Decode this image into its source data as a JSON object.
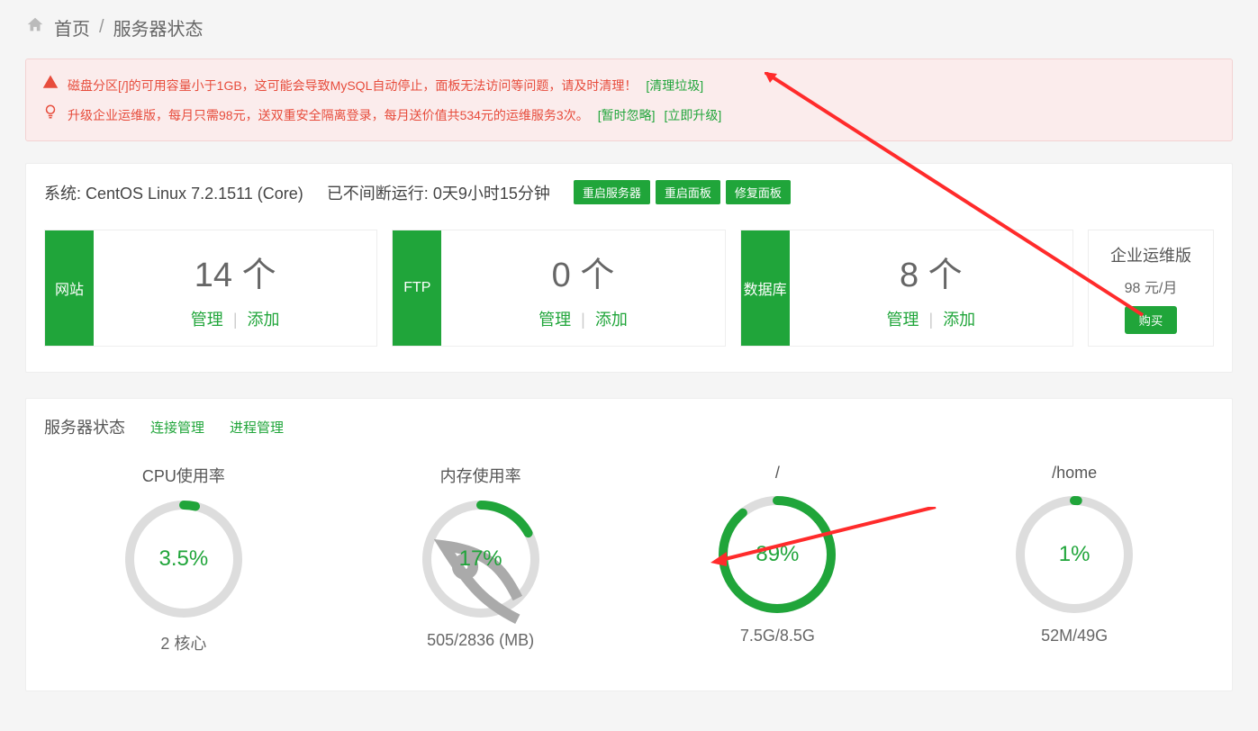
{
  "breadcrumb": {
    "home": "首页",
    "current": "服务器状态"
  },
  "alerts": {
    "disk_text": "磁盘分区[/]的可用容量小于1GB，这可能会导致MySQL自动停止，面板无法访问等问题，请及时清理！",
    "disk_action": "[清理垃圾]",
    "promo_text": "升级企业运维版，每月只需98元，送双重安全隔离登录，每月送价值共534元的运维服务3次。",
    "promo_ignore": "[暂时忽略]",
    "promo_upgrade": "[立即升级]"
  },
  "system": {
    "os_label": "系统: CentOS Linux 7.2.1511 (Core)",
    "uptime_label": "已不间断运行: 0天9小时15分钟",
    "btn_reboot_server": "重启服务器",
    "btn_reboot_panel": "重启面板",
    "btn_repair_panel": "修复面板"
  },
  "cards": [
    {
      "tab": "网站",
      "count": "14 个",
      "manage": "管理",
      "add": "添加"
    },
    {
      "tab": "FTP",
      "count": "0 个",
      "manage": "管理",
      "add": "添加"
    },
    {
      "tab": "数据库",
      "count": "8 个",
      "manage": "管理",
      "add": "添加"
    }
  ],
  "enterprise": {
    "title": "企业运维版",
    "price": "98 元/月",
    "buy": "购买"
  },
  "status": {
    "heading": "服务器状态",
    "link_conn": "连接管理",
    "link_proc": "进程管理"
  },
  "gauges": [
    {
      "title": "CPU使用率",
      "pct": 3.5,
      "pct_label": "3.5%",
      "sub": "2 核心",
      "rocket": false
    },
    {
      "title": "内存使用率",
      "pct": 17,
      "pct_label": "17%",
      "sub": "505/2836 (MB)",
      "rocket": true
    },
    {
      "title": "/",
      "pct": 89,
      "pct_label": "89%",
      "sub": "7.5G/8.5G",
      "rocket": false
    },
    {
      "title": "/home",
      "pct": 1,
      "pct_label": "1%",
      "sub": "52M/49G",
      "rocket": false
    }
  ]
}
